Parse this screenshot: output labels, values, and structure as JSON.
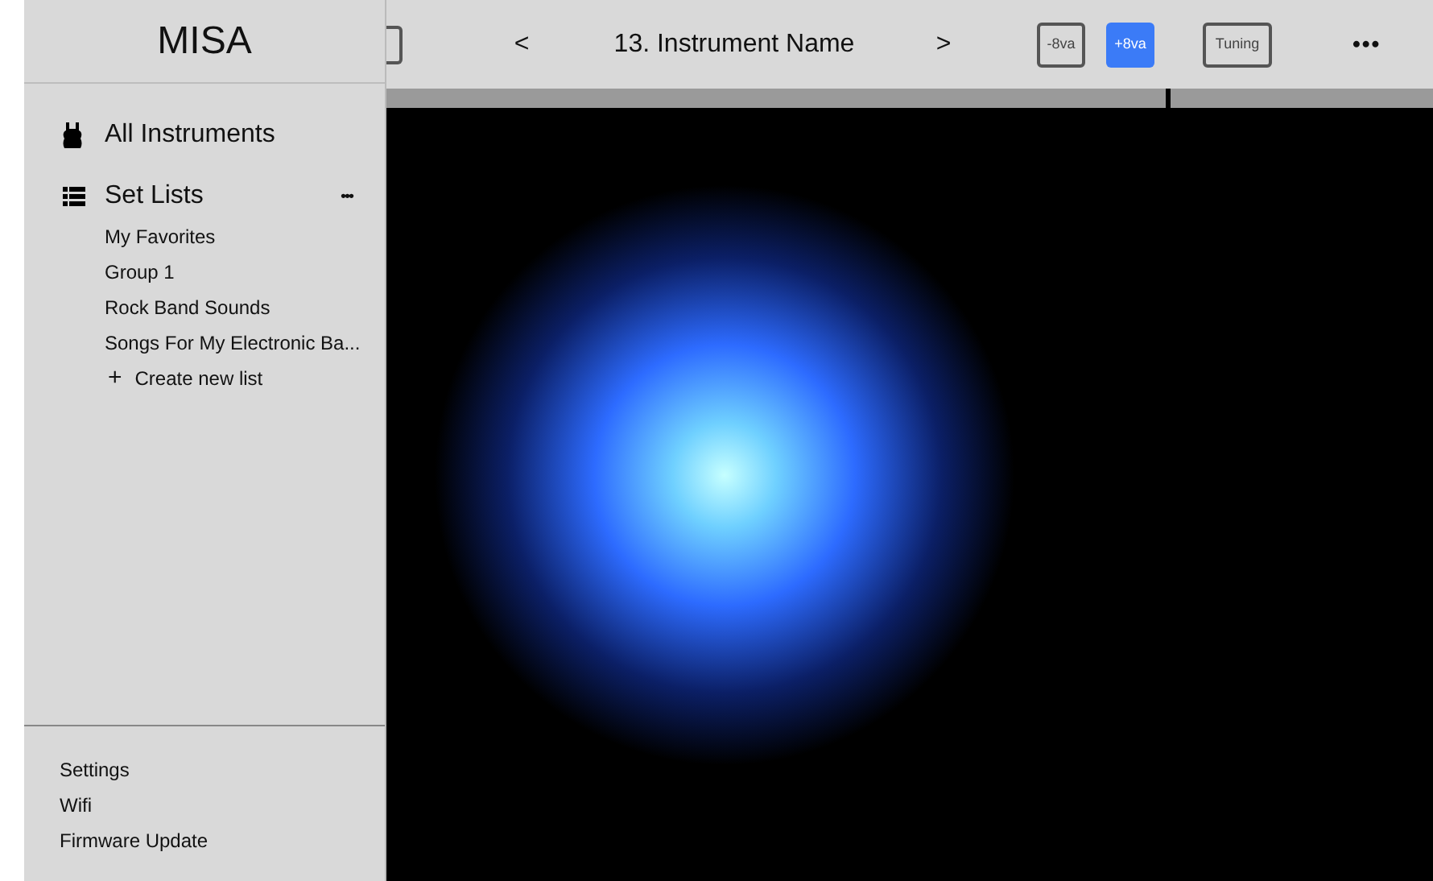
{
  "sidebar": {
    "title": "MISA",
    "nav": [
      {
        "kind": "instruments",
        "label": "All Instruments"
      },
      {
        "kind": "setlists",
        "label": "Set Lists",
        "more": "•••"
      }
    ],
    "set_lists": [
      "My Favorites",
      "Group 1",
      "Rock Band Sounds",
      "Songs For My Electronic Ba..."
    ],
    "create": {
      "icon": "+",
      "label": "Create new list"
    },
    "footer": [
      "Settings",
      "Wifi",
      "Firmware Update"
    ]
  },
  "toolbar": {
    "prev": "<",
    "title": "13. Instrument Name",
    "next": ">",
    "octave": [
      {
        "label": "-8va",
        "selected": false
      },
      {
        "label": "+8va",
        "selected": true
      }
    ],
    "tuning": "Tuning",
    "more": "•••"
  }
}
